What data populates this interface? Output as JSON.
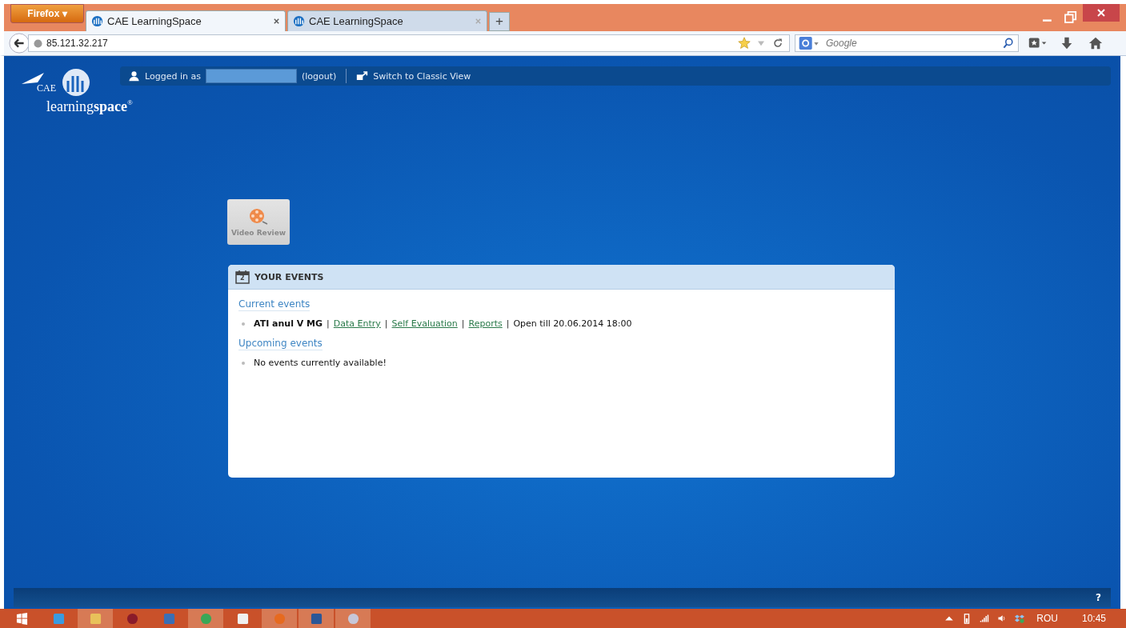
{
  "browser": {
    "menu_button": "Firefox ▾",
    "tabs": [
      {
        "label": "CAE LearningSpace",
        "selected": true
      },
      {
        "label": "CAE LearningSpace",
        "selected": false
      }
    ],
    "new_tab": "+",
    "url": "85.121.32.217",
    "search": {
      "placeholder": "Google"
    }
  },
  "header": {
    "logo_brand": "CAE",
    "logo_name": "learning**space**$^{®}$",
    "logged_in_label": "Logged in as",
    "logout": "(logout)",
    "switch_view": "Switch to Classic View"
  },
  "tiles": [
    {
      "label": "Video Review",
      "disabled": true
    }
  ],
  "events_panel": {
    "title": "YOUR EVENTS",
    "calendar_day": "2",
    "sections": [
      {
        "heading": "Current events",
        "items": [
          {
            "kind": "event",
            "name": "ATI anul V MG",
            "links": [
              "Data Entry",
              "Self Evaluation",
              "Reports"
            ],
            "separator": "|",
            "status": "Open till 20.06.2014 18:00"
          }
        ]
      },
      {
        "heading": "Upcoming events",
        "items": [
          {
            "kind": "message",
            "text": "No events currently available!"
          }
        ]
      }
    ]
  },
  "footer": {
    "help": "?"
  },
  "taskbar": {
    "apps": [
      {
        "kind": "start",
        "running": false
      },
      {
        "kind": "ie",
        "running": false
      },
      {
        "kind": "explorer",
        "running": true
      },
      {
        "kind": "media",
        "running": false
      },
      {
        "kind": "remote",
        "running": false
      },
      {
        "kind": "chrome",
        "running": true
      },
      {
        "kind": "grid",
        "running": false
      },
      {
        "kind": "firefox",
        "running": true
      },
      {
        "kind": "word",
        "running": true
      },
      {
        "kind": "paint",
        "running": true
      }
    ],
    "language": "ROU",
    "time": "10:45"
  }
}
